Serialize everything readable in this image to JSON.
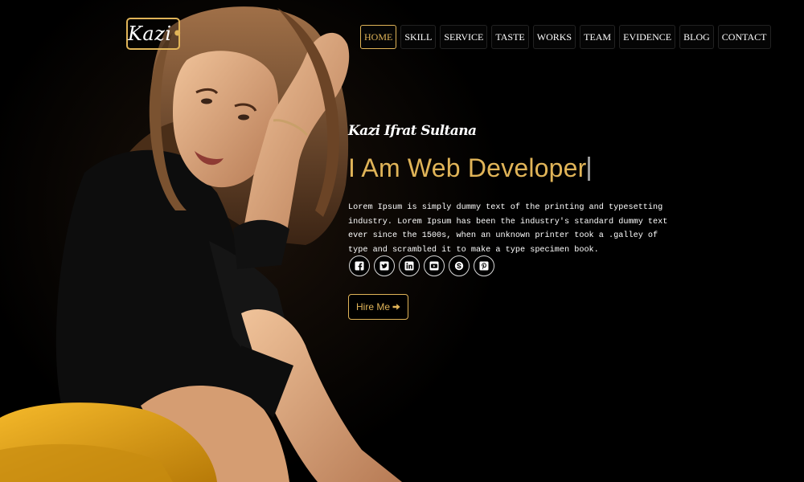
{
  "logo": {
    "text": "Kazi",
    "dot": "•"
  },
  "nav": {
    "items": [
      {
        "label": "HOME",
        "active": true
      },
      {
        "label": "SKILL",
        "active": false
      },
      {
        "label": "SERVICE",
        "active": false
      },
      {
        "label": "TASTE",
        "active": false
      },
      {
        "label": "WORKS",
        "active": false
      },
      {
        "label": "TEAM",
        "active": false
      },
      {
        "label": "EVIDENCE",
        "active": false
      },
      {
        "label": "BLOG",
        "active": false
      },
      {
        "label": "CONTACT",
        "active": false
      }
    ]
  },
  "hero": {
    "name": "Kazi Ifrat Sultana",
    "headline": "I Am Web Developer",
    "description": "Lorem Ipsum is simply dummy text of the printing and typesetting industry. Lorem Ipsum has been the industry's standard dummy text ever since the 1500s, when an unknown printer took a .galley of type and scrambled it to make a type specimen book.",
    "hire_label": "Hire Me"
  },
  "social": [
    "facebook-icon",
    "twitter-icon",
    "linkedin-icon",
    "youtube-icon",
    "skype-icon",
    "pinterest-icon"
  ],
  "colors": {
    "accent": "#e0b458",
    "background": "#000000",
    "text": "#ffffff",
    "chair": "#e8a817"
  }
}
